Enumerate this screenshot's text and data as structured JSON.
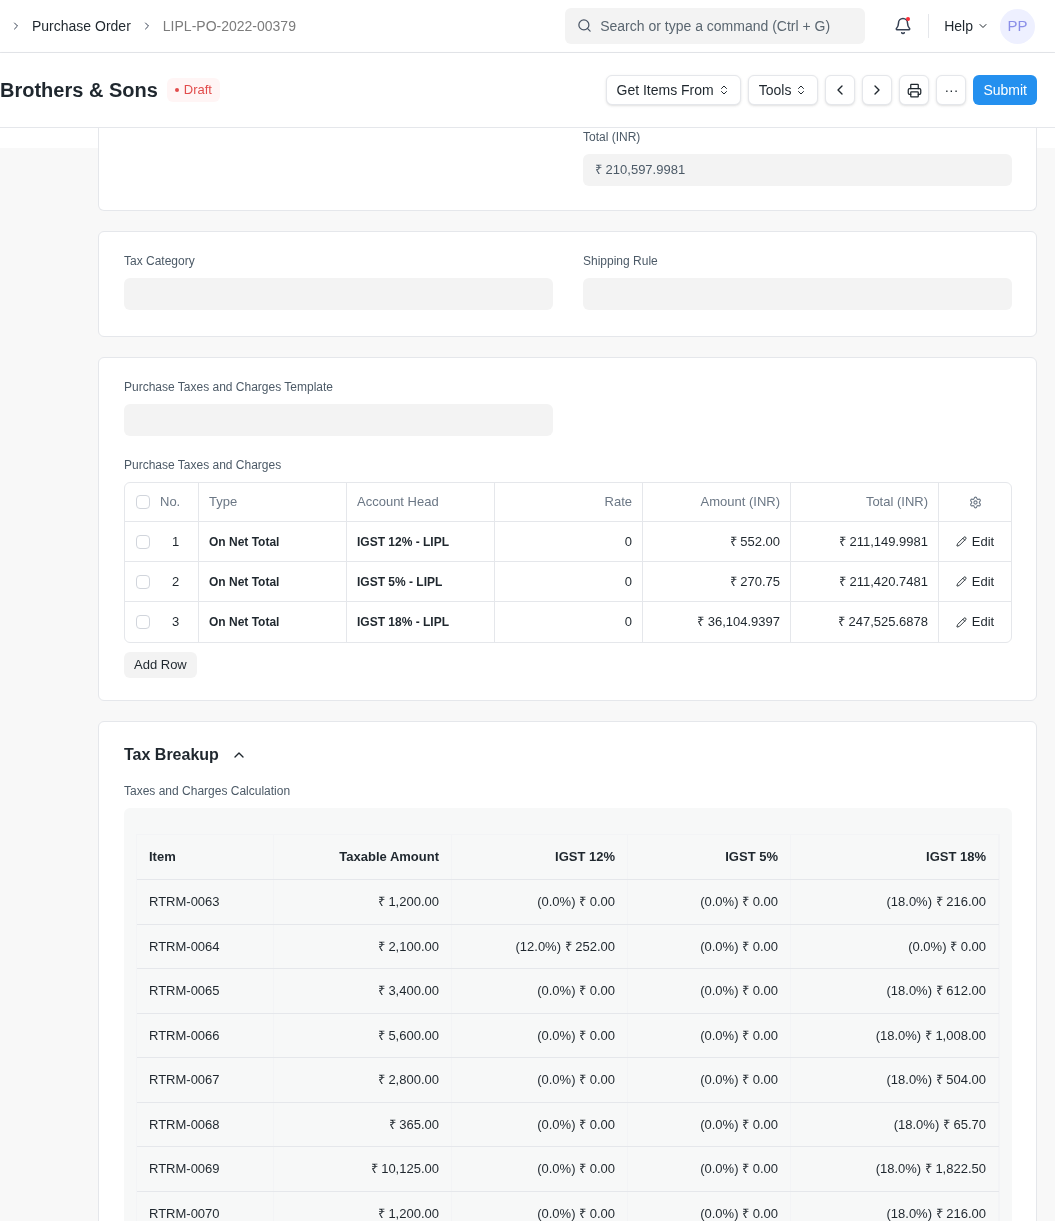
{
  "breadcrumbs": [
    "Purchase Order",
    "LIPL-PO-2022-00379"
  ],
  "search": {
    "placeholder": "Search or type a command (Ctrl + G)"
  },
  "notifications": {
    "unread": true
  },
  "help": "Help",
  "avatar": "PP",
  "title": "Brothers & Sons",
  "status": "Draft",
  "actions": [
    {
      "label": "Get Items From",
      "kind": "dropdown"
    },
    {
      "label": "Tools",
      "kind": "dropdown"
    },
    {
      "kind": "prev"
    },
    {
      "kind": "next"
    },
    {
      "kind": "print"
    },
    {
      "kind": "more",
      "label": "···"
    },
    {
      "label": "Submit",
      "kind": "primary"
    }
  ],
  "total_field": {
    "label": "Total (INR)",
    "value": "₹ 210,597.9981"
  },
  "tax_category": {
    "label": "Tax Category"
  },
  "shipping_rule": {
    "label": "Shipping Rule"
  },
  "template": {
    "label": "Purchase Taxes and Charges Template"
  },
  "taxes": {
    "label": "Purchase Taxes and Charges",
    "all_checked": false,
    "columns": [
      "No.",
      "Type",
      "Account Head",
      "Rate",
      "Amount (INR)",
      "Total (INR)"
    ],
    "rows": [
      {
        "checked": false,
        "no": "1",
        "type": "On Net Total",
        "account": "IGST 12% - LIPL",
        "rate": "0",
        "amount": "₹ 552.00",
        "total": "₹ 211,149.9981",
        "edit": "Edit"
      },
      {
        "checked": false,
        "no": "2",
        "type": "On Net Total",
        "account": "IGST 5% - LIPL",
        "rate": "0",
        "amount": "₹ 270.75",
        "total": "₹ 211,420.7481",
        "edit": "Edit"
      },
      {
        "checked": false,
        "no": "3",
        "type": "On Net Total",
        "account": "IGST 18% - LIPL",
        "rate": "0",
        "amount": "₹ 36,104.9397",
        "total": "₹ 247,525.6878",
        "edit": "Edit"
      }
    ],
    "add_row": "Add Row"
  },
  "tax_breakup": {
    "title": "Tax Breakup",
    "expanded": true,
    "label": "Taxes and Charges Calculation",
    "columns": [
      "Item",
      "Taxable Amount",
      "IGST 12%",
      "IGST 5%",
      "IGST 18%"
    ],
    "rows": [
      [
        "RTRM-0063",
        "₹ 1,200.00",
        "(0.0%) ₹ 0.00",
        "(0.0%) ₹ 0.00",
        "(18.0%) ₹ 216.00"
      ],
      [
        "RTRM-0064",
        "₹ 2,100.00",
        "(12.0%) ₹ 252.00",
        "(0.0%) ₹ 0.00",
        "(0.0%) ₹ 0.00"
      ],
      [
        "RTRM-0065",
        "₹ 3,400.00",
        "(0.0%) ₹ 0.00",
        "(0.0%) ₹ 0.00",
        "(18.0%) ₹ 612.00"
      ],
      [
        "RTRM-0066",
        "₹ 5,600.00",
        "(0.0%) ₹ 0.00",
        "(0.0%) ₹ 0.00",
        "(18.0%) ₹ 1,008.00"
      ],
      [
        "RTRM-0067",
        "₹ 2,800.00",
        "(0.0%) ₹ 0.00",
        "(0.0%) ₹ 0.00",
        "(18.0%) ₹ 504.00"
      ],
      [
        "RTRM-0068",
        "₹ 365.00",
        "(0.0%) ₹ 0.00",
        "(0.0%) ₹ 0.00",
        "(18.0%) ₹ 65.70"
      ],
      [
        "RTRM-0069",
        "₹ 10,125.00",
        "(0.0%) ₹ 0.00",
        "(0.0%) ₹ 0.00",
        "(18.0%) ₹ 1,822.50"
      ],
      [
        "RTRM-0070",
        "₹ 1,200.00",
        "(0.0%) ₹ 0.00",
        "(0.0%) ₹ 0.00",
        "(18.0%) ₹ 216.00"
      ]
    ]
  }
}
